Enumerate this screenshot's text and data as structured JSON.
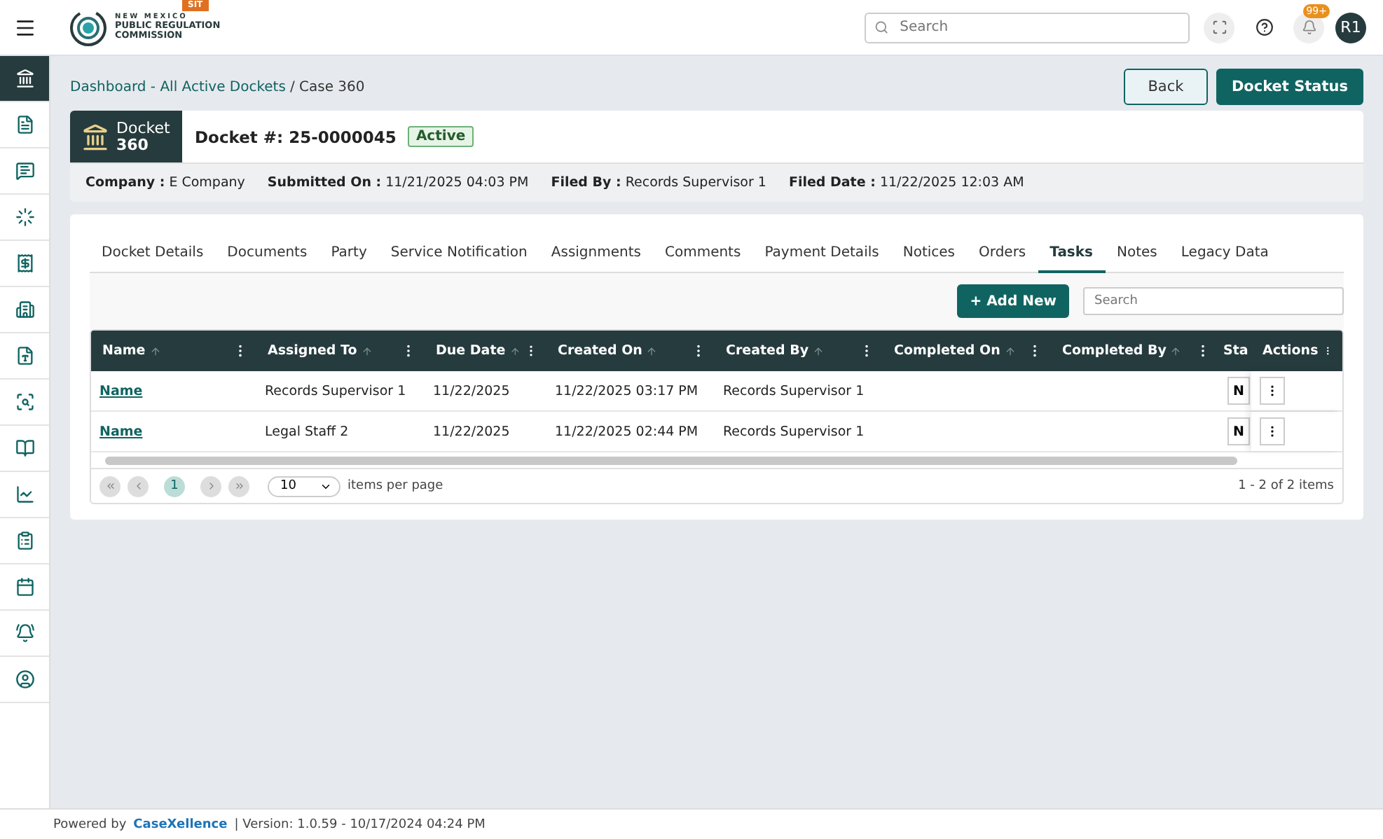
{
  "header": {
    "logo_lines": [
      "NEW MEXICO",
      "PUBLIC REGULATION",
      "COMMISSION"
    ],
    "env_badge": "SIT",
    "search": {
      "placeholder": "Search"
    },
    "notification_count": "99+",
    "avatar": "R1"
  },
  "sidebar": {
    "items": [
      {
        "selected": true
      },
      {
        "selected": false
      },
      {
        "selected": false
      },
      {
        "selected": false
      },
      {
        "selected": false
      },
      {
        "selected": false
      },
      {
        "selected": false
      },
      {
        "selected": false
      },
      {
        "selected": false
      },
      {
        "selected": false
      },
      {
        "selected": false
      },
      {
        "selected": false
      },
      {
        "selected": false
      },
      {
        "selected": false
      }
    ]
  },
  "breadcrumb": [
    {
      "label": "Dashboard - All Active Dockets",
      "kind": "link"
    },
    {
      "label": "/ Case 360",
      "kind": "current"
    }
  ],
  "actions": [
    {
      "label": "Back",
      "kind": "outline"
    },
    {
      "label": "Docket Status",
      "kind": "primary"
    }
  ],
  "docket": {
    "badge_title": "Docket",
    "badge_sub": "360",
    "number": "Docket #: 25-0000045",
    "status": "Active",
    "meta": [
      {
        "label": "Company :",
        "value": "E Company"
      },
      {
        "label": "Submitted On :",
        "value": "11/21/2025 04:03 PM"
      },
      {
        "label": "Filed By :",
        "value": "Records Supervisor 1"
      },
      {
        "label": "Filed Date :",
        "value": "11/22/2025 12:03 AM"
      }
    ]
  },
  "tabs": [
    {
      "label": "Docket Details",
      "selected": false
    },
    {
      "label": "Documents",
      "selected": false
    },
    {
      "label": "Party",
      "selected": false
    },
    {
      "label": "Service Notification",
      "selected": false
    },
    {
      "label": "Assignments",
      "selected": false
    },
    {
      "label": "Comments",
      "selected": false
    },
    {
      "label": "Payment Details",
      "selected": false
    },
    {
      "label": "Notices",
      "selected": false
    },
    {
      "label": "Orders",
      "selected": false
    },
    {
      "label": "Tasks",
      "selected": true
    },
    {
      "label": "Notes",
      "selected": false
    },
    {
      "label": "Legacy Data",
      "selected": false
    }
  ],
  "toolbar": {
    "add_button": "+ Add New",
    "search": {
      "placeholder": "Search"
    }
  },
  "table": {
    "columns": [
      {
        "label": "Name",
        "sortable": true
      },
      {
        "label": "Assigned To",
        "sortable": true
      },
      {
        "label": "Due Date",
        "sortable": true
      },
      {
        "label": "Created On",
        "sortable": true
      },
      {
        "label": "Created By",
        "sortable": true
      },
      {
        "label": "Completed On",
        "sortable": true
      },
      {
        "label": "Completed By",
        "sortable": true
      },
      {
        "label": "Sta"
      },
      {
        "label": "Actions",
        "sortable": false
      }
    ],
    "rows": [
      {
        "name": "Name",
        "assigned_to": "Records Supervisor 1",
        "due_date": "11/22/2025",
        "created_on": "11/22/2025 03:17 PM",
        "created_by": "Records Supervisor 1",
        "status": "N"
      },
      {
        "name": "Name",
        "assigned_to": "Legal Staff 2",
        "due_date": "11/22/2025",
        "created_on": "11/22/2025 02:44 PM",
        "created_by": "Records Supervisor 1",
        "status": "N"
      }
    ]
  },
  "pager": {
    "pages": [
      {
        "label": "1",
        "selected": true
      }
    ],
    "page_size": "10",
    "page_size_label": "items per page",
    "summary": "1 - 2 of 2 items"
  },
  "footer": {
    "powered_by": "Powered by",
    "brand": "CaseXellence",
    "version": "| Version: 1.0.59 - 10/17/2024 04:24 PM"
  }
}
